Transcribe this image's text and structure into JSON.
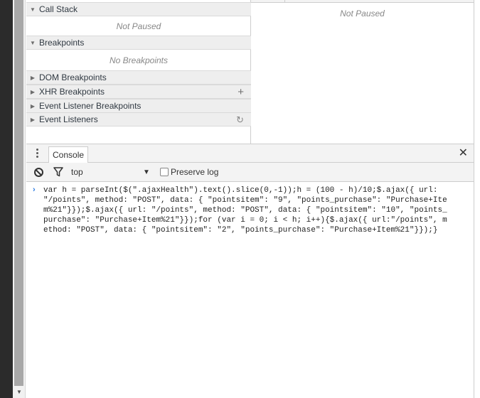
{
  "sources": {
    "call_stack": {
      "label": "Call Stack",
      "placeholder": "Not Paused"
    },
    "breakpoints": {
      "label": "Breakpoints",
      "placeholder": "No Breakpoints"
    },
    "dom_breakpoints": {
      "label": "DOM Breakpoints"
    },
    "xhr_breakpoints": {
      "label": "XHR Breakpoints",
      "action": "+"
    },
    "event_listener_breakpoints": {
      "label": "Event Listener Breakpoints"
    },
    "event_listeners": {
      "label": "Event Listeners",
      "action": "↻"
    },
    "right_panel": {
      "placeholder": "Not Paused"
    }
  },
  "drawer": {
    "tab_label": "Console",
    "close": "✕"
  },
  "console_toolbar": {
    "context_value": "top",
    "preserve_log_label": "Preserve log",
    "preserve_log_checked": false
  },
  "console": {
    "prompt": "›",
    "input": "var h = parseInt($(\".ajaxHealth\").text().slice(0,-1));h = (100 - h)/10;$.ajax({ url: \"/points\", method: \"POST\", data: { \"pointsitem\": \"9\", \"points_purchase\": \"Purchase+Item%21\"}});$.ajax({ url: \"/points\", method: \"POST\", data: { \"pointsitem\": \"10\", \"points_purchase\": \"Purchase+Item%21\"}});for (var i = 0; i < h; i++){$.ajax({ url:\"/points\", method: \"POST\", data: { \"pointsitem\": \"2\", \"points_purchase\": \"Purchase+Item%21\"}});}"
  },
  "icons": {
    "section_expanded": "▼",
    "section_collapsed": "▶",
    "context_dropdown": "▼",
    "scroll_down": "▼"
  }
}
